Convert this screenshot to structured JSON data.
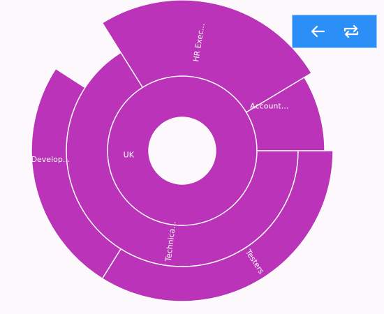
{
  "chart_data": {
    "type": "sunburst",
    "color": "#bb33b8",
    "background": "#fcf8fc",
    "levels": [
      [
        {
          "id": "uk",
          "label": "UK",
          "value": 300
        }
      ],
      [
        {
          "id": "hr",
          "label": "HR Exec...",
          "value": 67.5
        },
        {
          "id": "acc",
          "label": "Account...",
          "value": 67.5
        },
        {
          "id": "tech",
          "label": "Technica...",
          "value": 135
        }
      ],
      [
        {
          "id": "hr-2",
          "label": "HR Exec...",
          "value": 67.5
        },
        {
          "id": "acc-2",
          "label": "Account...",
          "value": 67.5
        },
        {
          "id": "testers",
          "label": "Testers",
          "value": 92
        },
        {
          "id": "develop",
          "label": "Develop...",
          "value": 81
        }
      ]
    ],
    "labels_shown": [
      "UK",
      "HR Exec...",
      "Account...",
      "Technica...",
      "Testers",
      "Develop..."
    ]
  },
  "toolbar": {
    "color": "#2b8ff7",
    "back_icon": "arrow-left-icon",
    "reset_icon": "repeat-icon"
  }
}
